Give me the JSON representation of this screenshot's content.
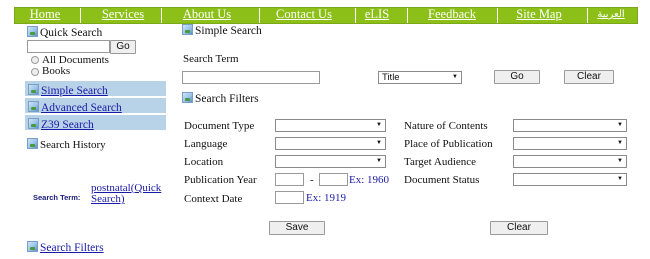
{
  "nav": {
    "items": [
      "Home",
      "Services",
      "About Us",
      "Contact Us",
      "eLIS",
      "Feedback",
      "Site Map",
      "العربية"
    ]
  },
  "sidebar": {
    "quick_search_title": "Quick Search",
    "quick_search_value": "",
    "go_label": "Go",
    "radio_all": "All Documents",
    "radio_books": "Books",
    "simple_search_link": "Simple Search",
    "advanced_search_link": "Advanced Search",
    "z39_search_link": "Z39 Search",
    "search_history_label": "Search History",
    "history_prefix": "Search Term:",
    "history_link": "postnatal(Quick Search)",
    "search_filters_link": "Search Filters"
  },
  "main": {
    "simple_search_heading": "Simple Search",
    "search_term_label": "Search Term",
    "search_term_value": "",
    "field_select": "Title",
    "go_label": "Go",
    "clear_label": "Clear",
    "filters_heading": "Search Filters",
    "document_type_label": "Document Type",
    "language_label": "Language",
    "location_label": "Location",
    "publication_year_label": "Publication Year",
    "year_dash": "-",
    "year_hint": "Ex: 1960",
    "context_date_label": "Context Date",
    "context_hint": "Ex: 1919",
    "nature_of_contents_label": "Nature of Contents",
    "place_of_publication_label": "Place of Publication",
    "target_audience_label": "Target Audience",
    "document_status_label": "Document Status",
    "save_label": "Save",
    "clear_bottom_label": "Clear"
  }
}
